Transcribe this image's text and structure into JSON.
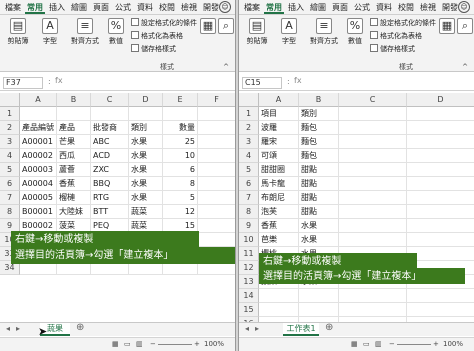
{
  "left": {
    "tabs": [
      "檔案",
      "常用",
      "插入",
      "繪圖",
      "頁面",
      "公式",
      "資料",
      "校閱",
      "檢視",
      "開發"
    ],
    "active_tab": "常用",
    "ribbon": {
      "clipboard": "剪貼簿",
      "font": "字型",
      "alignment": "對齊方式",
      "number": "數值",
      "percent_symbol": "%",
      "conditional_format": "設定格式化的條件",
      "format_as_table": "格式化為表格",
      "cell_styles": "儲存格樣式",
      "styles_group": "樣式",
      "cells": "儲存格",
      "editing": "編輯"
    },
    "namebox": "F37",
    "fx": "fx",
    "columns": [
      "A",
      "B",
      "C",
      "D",
      "E",
      "F"
    ],
    "rows": [
      {
        "n": "1",
        "cells": [
          "",
          "",
          "",
          "",
          "",
          ""
        ]
      },
      {
        "n": "2",
        "cells": [
          "產品編號",
          "產品",
          "批發商",
          "類別",
          "數量",
          ""
        ]
      },
      {
        "n": "3",
        "cells": [
          "A00001",
          "芒果",
          "ABC",
          "水果",
          "25",
          ""
        ]
      },
      {
        "n": "4",
        "cells": [
          "A00002",
          "西瓜",
          "ACD",
          "水果",
          "10",
          ""
        ]
      },
      {
        "n": "5",
        "cells": [
          "A00003",
          "蘆薈",
          "ZXC",
          "水果",
          "6",
          ""
        ]
      },
      {
        "n": "6",
        "cells": [
          "A00004",
          "香蕉",
          "BBQ",
          "水果",
          "8",
          ""
        ]
      },
      {
        "n": "7",
        "cells": [
          "A00005",
          "榴槤",
          "RTG",
          "水果",
          "5",
          ""
        ]
      },
      {
        "n": "8",
        "cells": [
          "B00001",
          "大陸妹",
          "BTT",
          "蔬菜",
          "12",
          ""
        ]
      },
      {
        "n": "9",
        "cells": [
          "B00002",
          "菠菜",
          "PEQ",
          "蔬菜",
          "15",
          ""
        ]
      },
      {
        "n": "10",
        "cells": [
          "B00003",
          "韭菜",
          "AFE",
          "蔬菜",
          "20",
          ""
        ]
      },
      {
        "n": "33",
        "cells": [
          "",
          "",
          "",
          "",
          "",
          ""
        ]
      },
      {
        "n": "34",
        "cells": [
          "",
          "",
          "",
          "",
          "",
          ""
        ]
      }
    ],
    "callout_line1": "右鍵→移動或複製",
    "callout_line2": "選擇目的活頁簿→勾選「建立複本」",
    "sheet_tab": "蔬果",
    "zoom": "100%"
  },
  "right": {
    "tabs": [
      "檔案",
      "常用",
      "插入",
      "繪圖",
      "頁面",
      "公式",
      "資料",
      "校閱",
      "檢視",
      "開發"
    ],
    "active_tab": "常用",
    "ribbon": {
      "clipboard": "剪貼簿",
      "font": "字型",
      "alignment": "對齊方式",
      "number": "數值",
      "percent_symbol": "%",
      "conditional_format": "設定格式化的條件",
      "format_as_table": "格式化為表格",
      "cell_styles": "儲存格樣式",
      "styles_group": "樣式",
      "cells": "儲存格",
      "editing": "編輯"
    },
    "namebox": "C15",
    "fx": "fx",
    "columns": [
      "A",
      "B",
      "C",
      "D"
    ],
    "rows": [
      {
        "n": "1",
        "cells": [
          "項目",
          "類別",
          "",
          ""
        ]
      },
      {
        "n": "2",
        "cells": [
          "波羅",
          "麵包",
          "",
          ""
        ]
      },
      {
        "n": "3",
        "cells": [
          "羅宋",
          "麵包",
          "",
          ""
        ]
      },
      {
        "n": "4",
        "cells": [
          "可頌",
          "麵包",
          "",
          ""
        ]
      },
      {
        "n": "5",
        "cells": [
          "甜甜圈",
          "甜點",
          "",
          ""
        ]
      },
      {
        "n": "6",
        "cells": [
          "馬卡龍",
          "甜點",
          "",
          ""
        ]
      },
      {
        "n": "7",
        "cells": [
          "布朗尼",
          "甜點",
          "",
          ""
        ]
      },
      {
        "n": "8",
        "cells": [
          "泡芙",
          "甜點",
          "",
          ""
        ]
      },
      {
        "n": "9",
        "cells": [
          "香蕉",
          "水果",
          "",
          ""
        ]
      },
      {
        "n": "10",
        "cells": [
          "芭樂",
          "水果",
          "",
          ""
        ]
      },
      {
        "n": "11",
        "cells": [
          "櫻桃",
          "水果",
          "",
          ""
        ]
      },
      {
        "n": "12",
        "cells": [
          "芒果",
          "水果",
          "",
          ""
        ]
      },
      {
        "n": "13",
        "cells": [
          "蘋果",
          "水果",
          "",
          ""
        ]
      },
      {
        "n": "14",
        "cells": [
          "",
          "",
          "",
          ""
        ]
      },
      {
        "n": "15",
        "cells": [
          "",
          "",
          "",
          ""
        ]
      },
      {
        "n": "16",
        "cells": [
          "",
          "",
          "",
          ""
        ]
      }
    ],
    "callout_line1": "右鍵→移動或複製",
    "callout_line2": "選擇目的活頁簿→勾選「建立複本」",
    "sheet_tab": "工作表1",
    "zoom": "100%"
  },
  "colors": {
    "accent": "#217346",
    "callout_bg": "#3c7a1d",
    "callout_text": "#ffffff"
  },
  "icons": {
    "sheet_add": "plus-icon",
    "feedback": "smiley-icon"
  }
}
